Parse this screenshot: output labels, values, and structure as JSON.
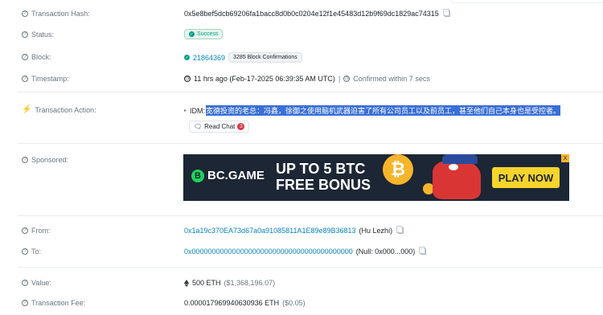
{
  "rows": {
    "tx_hash": {
      "label": "Transaction Hash:",
      "value": "0x5e8bef5dcb69206fa1bacc8d0b0c0204e12f1e45483d12b9f69dc1829ac74315"
    },
    "status": {
      "label": "Status:",
      "value": "Success"
    },
    "block": {
      "label": "Block:",
      "value": "21864369",
      "confirmations": "3285 Block Confirmations"
    },
    "timestamp": {
      "label": "Timestamp:",
      "value": "11 hrs ago (Feb-17-2025 06:39:35 AM UTC)",
      "separator": "|",
      "confirmed": "Confirmed within 7 secs"
    },
    "action": {
      "label": "Transaction Action:",
      "prefix": "IDM:",
      "message": "宽德投资的老总：冯鑫，徐御之使用脑机武器迫害了所有公司员工以及前员工，甚至他们自己本身也是受控者。",
      "chat_label": "Read Chat",
      "chat_count": "3"
    },
    "sponsored": {
      "label": "Sponsored:"
    },
    "from": {
      "label": "From:",
      "address": "0x1a19c370EA73d67a0a91085811A1E89e89B36813",
      "name": "(Hu Lezhi)"
    },
    "to": {
      "label": "To:",
      "address": "0x0000000000000000000000000000000000000000",
      "name": "(Null: 0x000...000)"
    },
    "value": {
      "label": "Value:",
      "amount": "500 ETH",
      "usd": "($1,368,196.07)"
    },
    "fee": {
      "label": "Transaction Fee:",
      "amount": "0.000017969940630936 ETH",
      "usd": "($0.05)"
    }
  },
  "ad": {
    "brand": "BC.GAME",
    "line1": "UP TO 5 BTC",
    "line2": "FREE BONUS",
    "cta": "PLAY NOW",
    "close": "X"
  },
  "icons": {
    "help": "question-circle-icon",
    "lightning": "lightning-icon",
    "clock": "clock-icon",
    "check": "check-circle-icon",
    "copy": "copy-icon",
    "eth": "ethereum-icon",
    "chat": "chat-icon"
  },
  "colors": {
    "link": "#0784c3",
    "success": "#00a186",
    "highlight": "#3a6fd8",
    "muted": "#6c757d"
  }
}
